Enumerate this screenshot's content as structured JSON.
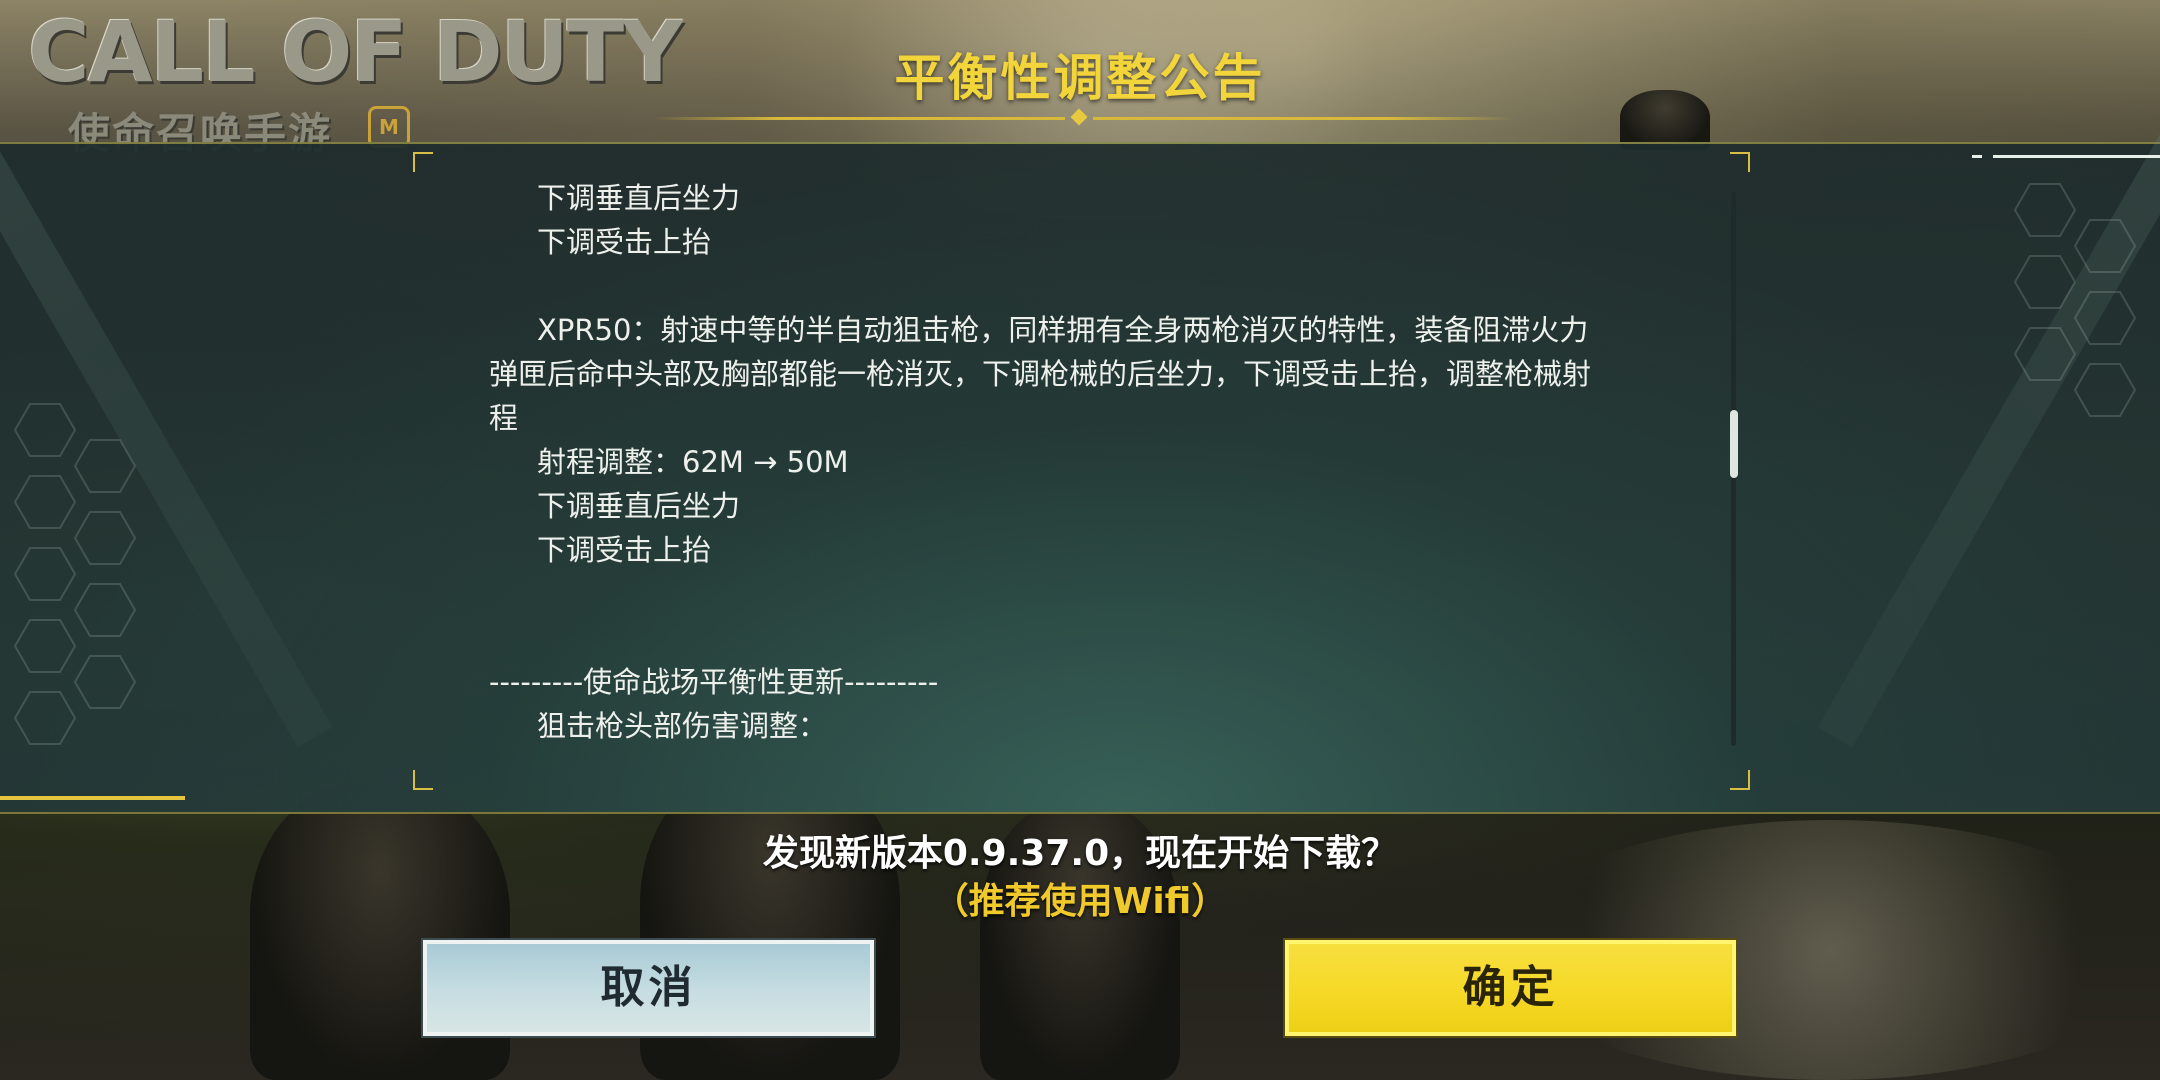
{
  "logo": {
    "wordmark": "CALL OF DUTY",
    "subtitle": "使命召唤手游",
    "mark": "M"
  },
  "dialog": {
    "title": "平衡性调整公告",
    "body_lines": [
      {
        "text": "下调垂直后坐力",
        "indent": true
      },
      {
        "text": "下调受击上抬",
        "indent": true
      },
      {
        "text": "",
        "indent": false
      },
      {
        "text": "XPR50：射速中等的半自动狙击枪，同样拥有全身两枪消灭的特性，装备阻滞火力",
        "indent": true
      },
      {
        "text": "弹匣后命中头部及胸部都能一枪消灭，下调枪械的后坐力，下调受击上抬，调整枪械射",
        "indent": false
      },
      {
        "text": "程",
        "indent": false
      },
      {
        "text": "射程调整：62M → 50M",
        "indent": true
      },
      {
        "text": "下调垂直后坐力",
        "indent": true
      },
      {
        "text": "下调受击上抬",
        "indent": true
      },
      {
        "text": "",
        "indent": false
      },
      {
        "text": "",
        "indent": false
      },
      {
        "text": "---------使命战场平衡性更新---------",
        "indent": false
      },
      {
        "text": "狙击枪头部伤害调整：",
        "indent": true
      }
    ],
    "scroll_position": 0.4
  },
  "prompt": {
    "message": "发现新版本0.9.37.0，现在开始下载？",
    "hint": "（推荐使用Wifi）"
  },
  "buttons": {
    "cancel_label": "取消",
    "confirm_label": "确定"
  },
  "colors": {
    "accent": "#f2d43b",
    "panel": "#243838",
    "cancel": "#c7dde2",
    "confirm": "#f6d927"
  }
}
